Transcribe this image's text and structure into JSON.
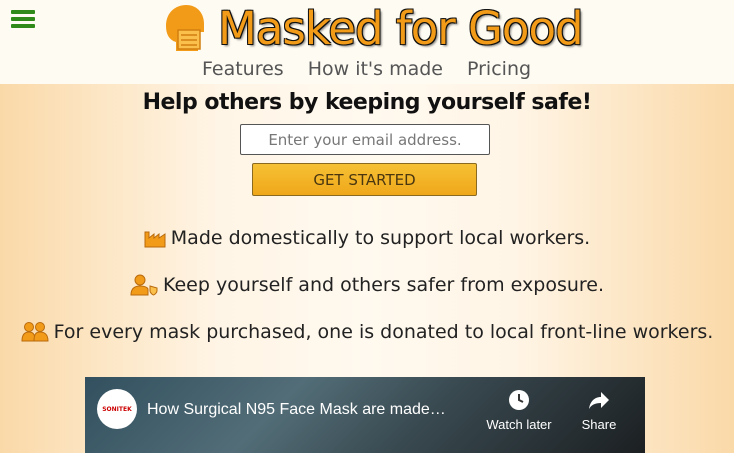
{
  "brand": {
    "name": "Masked for Good"
  },
  "nav": [
    {
      "label": "Features"
    },
    {
      "label": "How it's made"
    },
    {
      "label": "Pricing"
    }
  ],
  "hero": {
    "headline": "Help others by keeping yourself safe!",
    "email_placeholder": "Enter your email address.",
    "cta_label": "Get Started"
  },
  "features": [
    {
      "icon": "factory-icon",
      "text": "Made domestically to support local workers."
    },
    {
      "icon": "user-shield-icon",
      "text": "Keep yourself and others safer from exposure."
    },
    {
      "icon": "users-icon",
      "text": "For every mask purchased, one is donated to local front-line workers."
    }
  ],
  "video": {
    "channel": "SONITEK",
    "title": "How Surgical N95 Face Mask are made…",
    "watch_later": "Watch later",
    "share": "Share"
  },
  "colors": {
    "accent": "#f29b19",
    "menu": "#2f8a1a",
    "header_bg": "#fefbf3",
    "page_bg": "#fdeccd"
  }
}
